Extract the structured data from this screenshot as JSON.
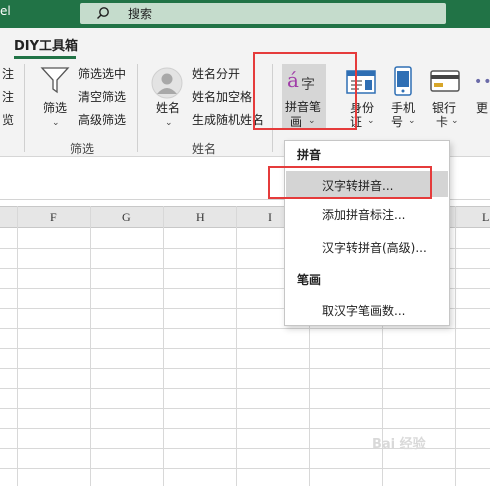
{
  "titlebar": {
    "app_label": "el",
    "search_placeholder": "搜索"
  },
  "tabs": {
    "active": "DIY工具箱"
  },
  "ribbon": {
    "partial_left": [
      "注",
      "注",
      "览"
    ],
    "filter_group": {
      "big_button": "筛选",
      "items": [
        "筛选选中",
        "清空筛选",
        "高级筛选"
      ],
      "label": "筛选"
    },
    "name_group": {
      "big_button": "姓名",
      "items": [
        "姓名分开",
        "姓名加空格",
        "生成随机姓名"
      ],
      "label": "姓名"
    },
    "pinyin_button": {
      "line1": "拼音笔",
      "line2": "画",
      "icon_text": "á字"
    },
    "id_button": {
      "line1": "身份",
      "line2": "证"
    },
    "phone_button": {
      "line1": "手机",
      "line2": "号"
    },
    "bank_button": {
      "line1": "银行",
      "line2": "卡"
    },
    "more_button": {
      "line1": "更"
    }
  },
  "grid": {
    "columns": [
      "F",
      "G",
      "H",
      "I",
      "L"
    ]
  },
  "menu": {
    "section1": "拼音",
    "items1": [
      "汉字转拼音...",
      "添加拼音标注...",
      "汉字转拼音(高级)..."
    ],
    "section2": "笔画",
    "items2": [
      "取汉字笔画数..."
    ]
  },
  "watermark": "Bai 经验",
  "colors": {
    "accent": "#217346",
    "highlight": "#e53b3b"
  }
}
